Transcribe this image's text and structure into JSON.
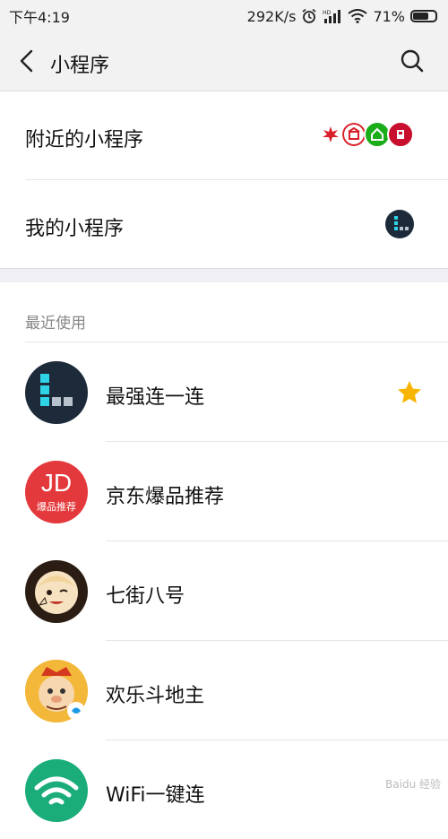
{
  "status_bar": {
    "time": "下午4:19",
    "speed": "292K/s",
    "battery": "71%",
    "battery_level": 0.71,
    "icons": [
      "alarm-icon",
      "signal-icon",
      "wifi-icon",
      "battery-icon"
    ]
  },
  "nav": {
    "title": "小程序",
    "icons": [
      "back-arrow-icon",
      "search-icon"
    ]
  },
  "entries": {
    "nearby": "附近的小程序",
    "mine": "我的小程序"
  },
  "recent": {
    "header": "最近使用",
    "items": [
      {
        "name": "最强连一连",
        "starred": true
      },
      {
        "name": "京东爆品推荐",
        "icon_text": "JD",
        "icon_sub": "爆品推荐",
        "icon_color": "#e4393c"
      },
      {
        "name": "七街八号"
      },
      {
        "name": "欢乐斗地主"
      },
      {
        "name": "WiFi一键连",
        "icon_color": "#1aad7a"
      }
    ]
  },
  "watermark": "Baidu 经验"
}
